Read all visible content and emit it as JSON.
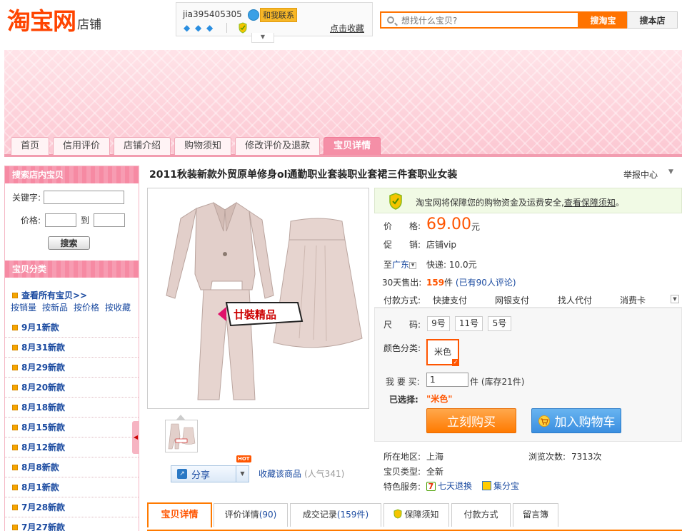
{
  "header": {
    "logo_main": "淘宝网",
    "logo_sub": "店铺",
    "seller_name": "jia395405305",
    "contact_label": "和我联系",
    "favorite_link": "点击收藏",
    "search_placeholder": "想找什么宝贝?",
    "search_taobao_btn": "搜淘宝",
    "search_store_btn": "搜本店"
  },
  "nav": {
    "tabs": [
      "首页",
      "信用评价",
      "店铺介绍",
      "购物须知",
      "修改评价及退款",
      "宝贝详情"
    ],
    "active_index": 5
  },
  "sidebar": {
    "search_title": "搜索店内宝贝",
    "keyword_label": "关键字:",
    "price_label": "价格:",
    "price_to": "到",
    "search_btn": "搜索",
    "category_title": "宝贝分类",
    "view_all": "查看所有宝贝>>",
    "sort_links": [
      "按销量",
      "按新品",
      "按价格",
      "按收藏"
    ],
    "categories": [
      "9月1新款",
      "8月31新款",
      "8月29新款",
      "8月20新款",
      "8月18新款",
      "8月15新款",
      "8月12新款",
      "8月8新款",
      "8月1新款",
      "7月28新款",
      "7月27新款"
    ]
  },
  "product": {
    "title": "2011秋装新款外贸原单修身ol通勤职业套装职业套裙三件套职业女装",
    "report_center": "举报中心",
    "image_badge": "廿裝精品",
    "share_label": "分享",
    "hot_badge": "HOT",
    "favorite_product": "收藏该商品",
    "popularity": "(人气341)",
    "guarantee_text": "淘宝网将保障您的购物资金及运费安全,",
    "guarantee_link": "查看保障须知",
    "guarantee_end": "。",
    "price_label": "价　　格:",
    "price_value": "69.00",
    "price_unit": "元",
    "promo_label": "促　　销:",
    "promo_value": "店铺vip",
    "ship_to": "至",
    "ship_region": "广东",
    "ship_value": "快递: 10.0元",
    "sold_label": "30天售出:",
    "sold_count": "159",
    "sold_unit": "件",
    "review_text": "(已有90人评论)",
    "pay_label": "付款方式:",
    "pay_methods": [
      "快捷支付",
      "网银支付",
      "找人代付",
      "消费卡"
    ],
    "size_label": "尺　　码:",
    "sizes": [
      "9号",
      "11号",
      "5号"
    ],
    "color_label": "颜色分类:",
    "colors": [
      "米色"
    ],
    "qty_label": "我 要 买:",
    "qty_value": "1",
    "qty_unit": "件 (库存21件)",
    "selected_label": "已选择:",
    "selected_value": "\"米色\"",
    "buy_btn": "立刻购买",
    "cart_btn": "加入购物车",
    "location_label": "所在地区:",
    "location_value": "上海",
    "views_label": "浏览次数:",
    "views_value": "7313次",
    "type_label": "宝贝类型:",
    "type_value": "全新",
    "service_label": "特色服务:",
    "service_1": "七天退换",
    "service_2": "集分宝"
  },
  "tabs": {
    "detail": "宝贝详情",
    "reviews": "评价详情",
    "reviews_count": "(90)",
    "records": "成交记录",
    "records_count": "(159件)",
    "guarantee": "保障须知",
    "payment": "付款方式",
    "guestbook": "留言簿"
  },
  "colors": {
    "accent_orange": "#ff7300",
    "price_orange": "#ff5500",
    "link_blue": "#1a4aa0",
    "banner_pink": "#fcc7d2"
  }
}
